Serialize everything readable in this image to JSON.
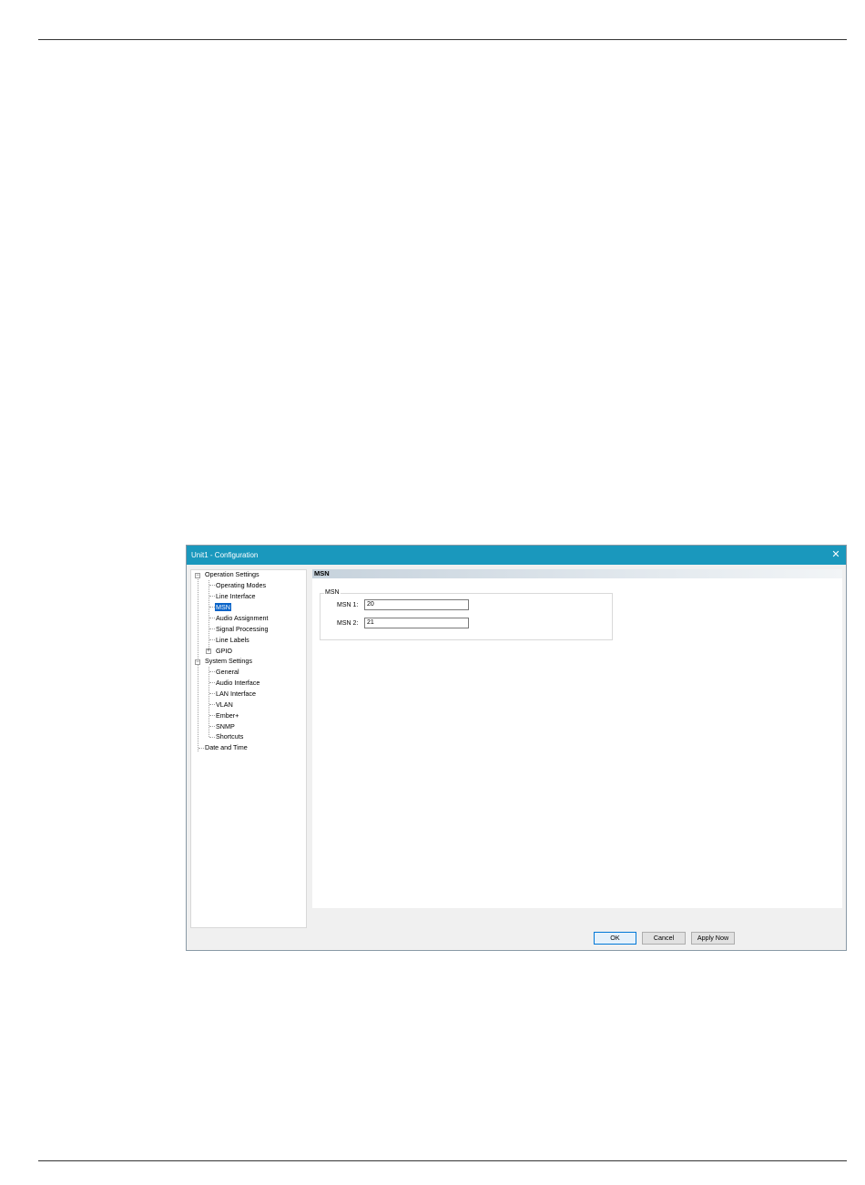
{
  "dialog": {
    "title": "Unit1 - Configuration",
    "close_glyph": "✕"
  },
  "tree": {
    "items": [
      {
        "label": "Operation Settings",
        "level": 0,
        "expander": "−"
      },
      {
        "label": "Operating Modes",
        "level": 1
      },
      {
        "label": "Line Interface",
        "level": 1
      },
      {
        "label": "MSN",
        "level": 1,
        "selected": true
      },
      {
        "label": "Audio Assignment",
        "level": 1
      },
      {
        "label": "Signal Processing",
        "level": 1
      },
      {
        "label": "Line Labels",
        "level": 1
      },
      {
        "label": "GPIO",
        "level": 1,
        "expander": "+"
      },
      {
        "label": "System Settings",
        "level": 0,
        "expander": "−"
      },
      {
        "label": "General",
        "level": 1
      },
      {
        "label": "Audio Interface",
        "level": 1
      },
      {
        "label": "LAN Interface",
        "level": 1
      },
      {
        "label": "VLAN",
        "level": 1
      },
      {
        "label": "Ember+",
        "level": 1
      },
      {
        "label": "SNMP",
        "level": 1
      },
      {
        "label": "Shortcuts",
        "level": 1
      },
      {
        "label": "Date and Time",
        "level": 0
      }
    ]
  },
  "content": {
    "section_title": "MSN",
    "group_title": "MSN",
    "fields": [
      {
        "label": "MSN 1:",
        "value": "20"
      },
      {
        "label": "MSN 2:",
        "value": "21"
      }
    ]
  },
  "buttons": {
    "ok": "OK",
    "cancel": "Cancel",
    "apply": "Apply Now"
  }
}
